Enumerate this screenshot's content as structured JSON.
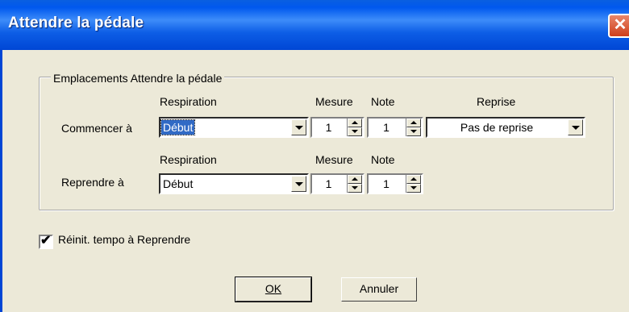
{
  "window": {
    "title": "Attendre la pédale",
    "close_glyph": "✕"
  },
  "group": {
    "legend": "Emplacements Attendre la pédale"
  },
  "headers": {
    "respiration": "Respiration",
    "mesure": "Mesure",
    "note": "Note",
    "reprise": "Reprise"
  },
  "row1": {
    "label": "Commencer à",
    "respiration": "Début",
    "mesure": "1",
    "note": "1",
    "reprise": "Pas de reprise"
  },
  "row2": {
    "label": "Reprendre à",
    "respiration": "Début",
    "mesure": "1",
    "note": "1"
  },
  "reset_tempo": {
    "label": "Réinit. tempo à Reprendre",
    "checked": true,
    "check_glyph": "✔"
  },
  "buttons": {
    "ok": "OK",
    "cancel": "Annuler"
  }
}
